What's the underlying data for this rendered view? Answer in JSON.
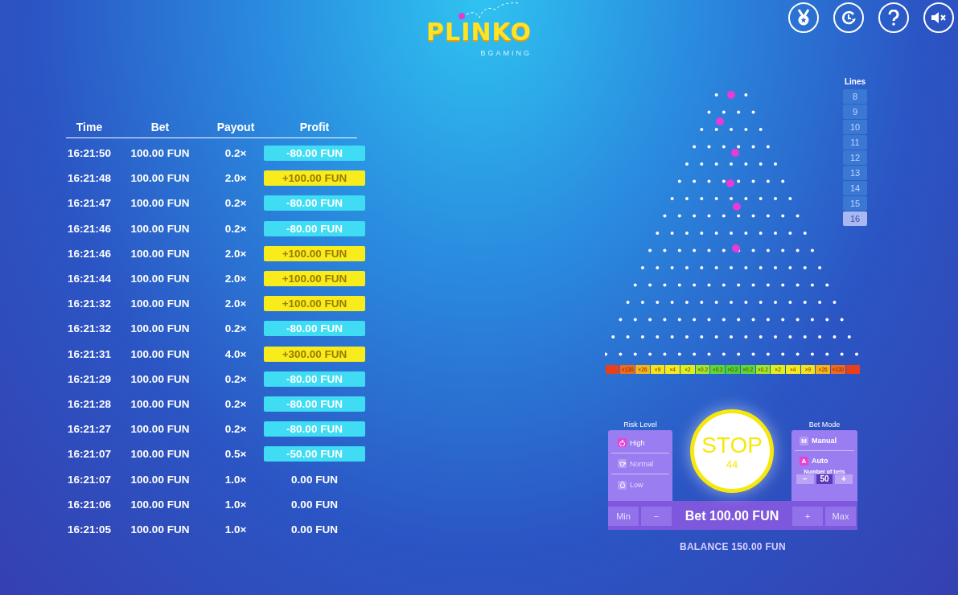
{
  "logo": {
    "title": "PLINKO",
    "brand": "BGAMING"
  },
  "toolbar": [
    {
      "kind": "medal"
    },
    {
      "kind": "history"
    },
    {
      "kind": "help"
    },
    {
      "kind": "mute"
    }
  ],
  "history": {
    "columns": [
      "Time",
      "Bet",
      "Payout",
      "Profit"
    ],
    "rows": [
      {
        "time": "16:21:50",
        "bet": "100.00 FUN",
        "payout": "0.2×",
        "profit": "-80.00 FUN",
        "kind": "loss"
      },
      {
        "time": "16:21:48",
        "bet": "100.00 FUN",
        "payout": "2.0×",
        "profit": "+100.00 FUN",
        "kind": "win"
      },
      {
        "time": "16:21:47",
        "bet": "100.00 FUN",
        "payout": "0.2×",
        "profit": "-80.00 FUN",
        "kind": "loss"
      },
      {
        "time": "16:21:46",
        "bet": "100.00 FUN",
        "payout": "0.2×",
        "profit": "-80.00 FUN",
        "kind": "loss"
      },
      {
        "time": "16:21:46",
        "bet": "100.00 FUN",
        "payout": "2.0×",
        "profit": "+100.00 FUN",
        "kind": "win"
      },
      {
        "time": "16:21:44",
        "bet": "100.00 FUN",
        "payout": "2.0×",
        "profit": "+100.00 FUN",
        "kind": "win"
      },
      {
        "time": "16:21:32",
        "bet": "100.00 FUN",
        "payout": "2.0×",
        "profit": "+100.00 FUN",
        "kind": "win"
      },
      {
        "time": "16:21:32",
        "bet": "100.00 FUN",
        "payout": "0.2×",
        "profit": "-80.00 FUN",
        "kind": "loss"
      },
      {
        "time": "16:21:31",
        "bet": "100.00 FUN",
        "payout": "4.0×",
        "profit": "+300.00 FUN",
        "kind": "win"
      },
      {
        "time": "16:21:29",
        "bet": "100.00 FUN",
        "payout": "0.2×",
        "profit": "-80.00 FUN",
        "kind": "loss"
      },
      {
        "time": "16:21:28",
        "bet": "100.00 FUN",
        "payout": "0.2×",
        "profit": "-80.00 FUN",
        "kind": "loss"
      },
      {
        "time": "16:21:27",
        "bet": "100.00 FUN",
        "payout": "0.2×",
        "profit": "-80.00 FUN",
        "kind": "loss"
      },
      {
        "time": "16:21:07",
        "bet": "100.00 FUN",
        "payout": "0.5×",
        "profit": "-50.00 FUN",
        "kind": "loss"
      },
      {
        "time": "16:21:07",
        "bet": "100.00 FUN",
        "payout": "1.0×",
        "profit": "0.00 FUN",
        "kind": "even"
      },
      {
        "time": "16:21:06",
        "bet": "100.00 FUN",
        "payout": "1.0×",
        "profit": "0.00 FUN",
        "kind": "even"
      },
      {
        "time": "16:21:05",
        "bet": "100.00 FUN",
        "payout": "1.0×",
        "profit": "0.00 FUN",
        "kind": "even"
      }
    ]
  },
  "lines": {
    "label": "Lines",
    "options": [
      {
        "label": "8",
        "selected": false
      },
      {
        "label": "9",
        "selected": false
      },
      {
        "label": "10",
        "selected": false
      },
      {
        "label": "11",
        "selected": false
      },
      {
        "label": "12",
        "selected": false
      },
      {
        "label": "13",
        "selected": false
      },
      {
        "label": "14",
        "selected": false
      },
      {
        "label": "15",
        "selected": false
      },
      {
        "label": "16",
        "selected": true
      }
    ]
  },
  "slots": [
    {
      "color": "#e8401c"
    },
    {
      "label": "×130",
      "color": "#f06a1e"
    },
    {
      "label": "×26",
      "color": "#f6b21a"
    },
    {
      "label": "×9",
      "color": "#f4e21c"
    },
    {
      "label": "×4",
      "color": "#f4ea1c"
    },
    {
      "label": "×2",
      "color": "#def01c"
    },
    {
      "label": "×0.2",
      "color": "#9ee82a"
    },
    {
      "label": "×0.2",
      "color": "#5cd836"
    },
    {
      "label": "×0.2",
      "color": "#4cd03a"
    },
    {
      "label": "×0.2",
      "color": "#5cd836"
    },
    {
      "label": "×0.2",
      "color": "#9ee82a"
    },
    {
      "label": "×2",
      "color": "#def01c"
    },
    {
      "label": "×4",
      "color": "#f4ea1c"
    },
    {
      "label": "×9",
      "color": "#f4e21c"
    },
    {
      "label": "×26",
      "color": "#f6b21a"
    },
    {
      "label": "×130",
      "color": "#f06a1e"
    },
    {
      "color": "#e8401c"
    }
  ],
  "risk": {
    "title": "Risk Level",
    "options": [
      {
        "label": "High",
        "kind": "high",
        "selected": true
      },
      {
        "label": "Normal",
        "kind": "normal",
        "selected": false
      },
      {
        "label": "Low",
        "kind": "low",
        "selected": false
      }
    ]
  },
  "stop": {
    "label": "STOP",
    "count": "44"
  },
  "bet_mode": {
    "title": "Bet Mode",
    "options": [
      {
        "label": "Manual",
        "key": "M",
        "selected": false
      },
      {
        "label": "Auto",
        "key": "A",
        "selected": true
      }
    ],
    "bets_label": "Number of bets",
    "bets_value": "50",
    "minus": "−",
    "plus": "+"
  },
  "bet_bar": {
    "min": "Min",
    "minus": "−",
    "bet": "Bet 100.00 FUN",
    "plus": "+",
    "max": "Max"
  },
  "balance": "BALANCE 150.00 FUN"
}
